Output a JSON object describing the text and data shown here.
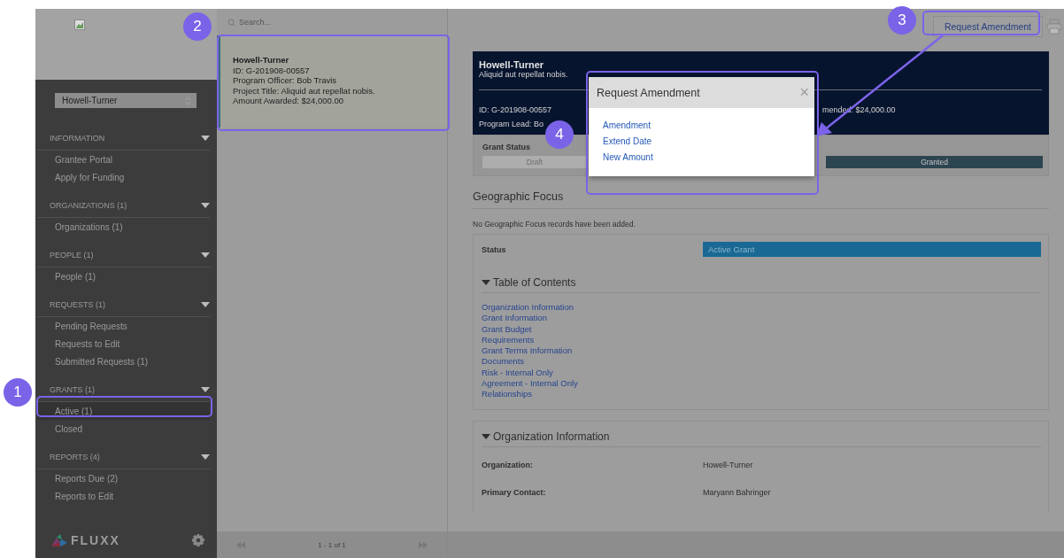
{
  "sidebar": {
    "organization_select": "Howell-Turner",
    "sections": [
      {
        "title": "INFORMATION",
        "expanded": true,
        "items": [
          {
            "label": "Grantee Portal",
            "selected": false
          },
          {
            "label": "Apply for Funding",
            "selected": false
          }
        ]
      },
      {
        "title": "ORGANIZATIONS (1)",
        "expanded": true,
        "items": [
          {
            "label": "Organizations  (1)",
            "selected": false
          }
        ]
      },
      {
        "title": "PEOPLE (1)",
        "expanded": true,
        "items": [
          {
            "label": "People  (1)",
            "selected": false
          }
        ]
      },
      {
        "title": "REQUESTS (1)",
        "expanded": true,
        "items": [
          {
            "label": "Pending Requests",
            "selected": false
          },
          {
            "label": "Requests to Edit",
            "selected": false
          },
          {
            "label": "Submitted Requests  (1)",
            "selected": false
          }
        ]
      },
      {
        "title": "GRANTS (1)",
        "expanded": true,
        "items": [
          {
            "label": "Active  (1)",
            "selected": true
          },
          {
            "label": "Closed",
            "selected": false
          }
        ]
      },
      {
        "title": "REPORTS (4)",
        "expanded": true,
        "items": [
          {
            "label": "Reports Due  (2)",
            "selected": false
          },
          {
            "label": "Reports to Edit",
            "selected": false
          }
        ]
      }
    ],
    "logo": "FLUXX"
  },
  "search": {
    "placeholder": "Search..."
  },
  "cards": [
    {
      "title": "Howell-Turner",
      "lines": [
        "ID: G-201908-00557",
        "Program Officer: Bob Travis",
        "Project Title: Aliquid aut repellat nobis.",
        "Amount Awarded: $24,000.00"
      ],
      "selected": true
    }
  ],
  "pagination": "1 - 1 of 1",
  "toolbar": {
    "button": "Request Amendment"
  },
  "grant_header": {
    "title": "Howell-Turner",
    "subtitle": "Aliquid aut repellat nobis.",
    "left_lines": [
      "ID: G-201908-00557",
      "Program Lead: Bo"
    ],
    "right_line": "mended: $24,000.00"
  },
  "grant_status": {
    "label": "Grant Status",
    "steps": [
      {
        "label": "Draft",
        "selected": false
      },
      {
        "label": "Granted",
        "selected": true
      }
    ]
  },
  "geographic_focus": {
    "title": "Geographic Focus",
    "note": "No Geographic Focus records have been added."
  },
  "status": {
    "label": "Status",
    "value": "Active Grant"
  },
  "table_of_contents": {
    "title": "Table of Contents",
    "expanded": true,
    "links": [
      "Organization Information",
      "Grant Information",
      "Grant Budget",
      "Requirements",
      "Grant Terms Information",
      "Documents",
      "Risk - Internal Only",
      "Agreement - Internal Only",
      "Relationships"
    ]
  },
  "organization_information": {
    "title": "Organization Information",
    "expanded": true,
    "rows": [
      {
        "label": "Organization:",
        "value": "Howell-Turner"
      },
      {
        "label": "Primary Contact:",
        "value": "Maryann Bahringer"
      }
    ]
  },
  "modal": {
    "title": "Request Amendment",
    "close": "×",
    "options": [
      "Amendment",
      "Extend Date",
      "New Amount"
    ]
  },
  "annotations": [
    {
      "label": "1"
    },
    {
      "label": "2"
    },
    {
      "label": "3"
    },
    {
      "label": "4"
    }
  ]
}
